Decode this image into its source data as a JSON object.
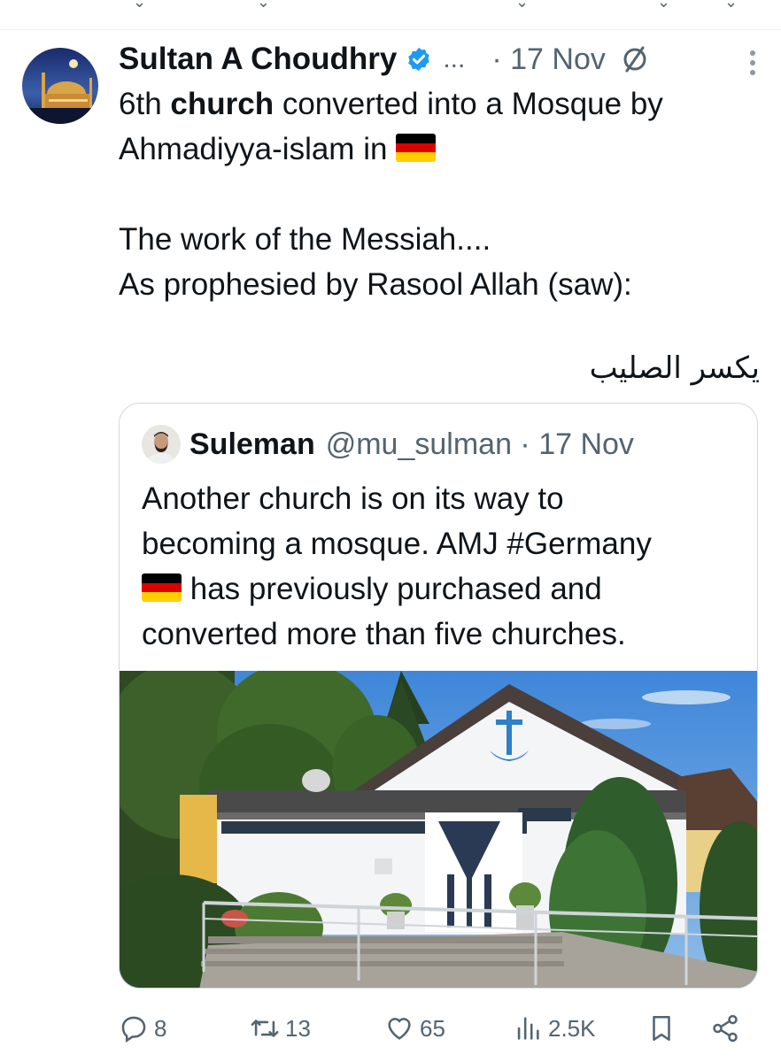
{
  "tweet": {
    "author": {
      "display_name": "Sultan A Choudhry",
      "verified": true,
      "ellipsis": "...",
      "date": "· 17 Nov"
    },
    "text": {
      "line1_prefix": "6th ",
      "line1_bold": "church",
      "line1_suffix": " converted into a Mosque by",
      "line2": "Ahmadiyya-islam in ",
      "line4": "The work of the Messiah....",
      "line5": "As prophesied by Rasool Allah (saw):",
      "arabic": "يكسر الصليب"
    },
    "icons": {
      "verified": "verified-badge-icon",
      "translate": "translate-icon",
      "more": "more-options-icon",
      "flag": "germany-flag-emoji"
    }
  },
  "quote": {
    "author": {
      "display_name": "Suleman",
      "handle": "@mu_sulman · 17 Nov"
    },
    "text": {
      "line1": "Another church is on its way to",
      "line2": "becoming a mosque. AMJ #Germany",
      "line3": " has previously purchased and",
      "line4": "converted more than five churches."
    }
  },
  "actions": {
    "replies": "8",
    "retweets": "13",
    "likes": "65",
    "views": "2.5K"
  },
  "colors": {
    "text": "#0f1419",
    "secondary": "#536471",
    "verified": "#1d9bf0",
    "border": "#cfd9de",
    "flag_black": "#000000",
    "flag_red": "#dd0000",
    "flag_gold": "#ffce00"
  }
}
